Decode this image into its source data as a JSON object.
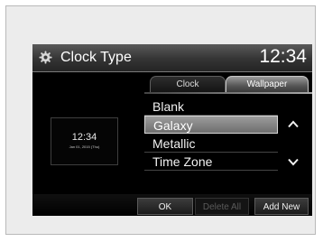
{
  "header": {
    "title": "Clock Type",
    "time": "12:34",
    "icon": "gear-icon"
  },
  "tabs": [
    {
      "label": "Clock",
      "active": false
    },
    {
      "label": "Wallpaper",
      "active": true
    }
  ],
  "preview": {
    "time": "12:34",
    "date": "Jan 01, 2015 (Thu)"
  },
  "list": {
    "items": [
      {
        "label": "Blank",
        "selected": false
      },
      {
        "label": "Galaxy",
        "selected": true
      },
      {
        "label": "Metallic",
        "selected": false
      },
      {
        "label": "Time Zone",
        "selected": false
      }
    ],
    "scroll_up_icon": "chevron-up-icon",
    "scroll_down_icon": "chevron-down-icon"
  },
  "buttons": {
    "ok": "OK",
    "delete_all": "Delete All",
    "add_new": "Add New"
  },
  "colors": {
    "screen_bg": "#000000",
    "selected_row": "#8a8a8a",
    "text": "#ffffff"
  }
}
